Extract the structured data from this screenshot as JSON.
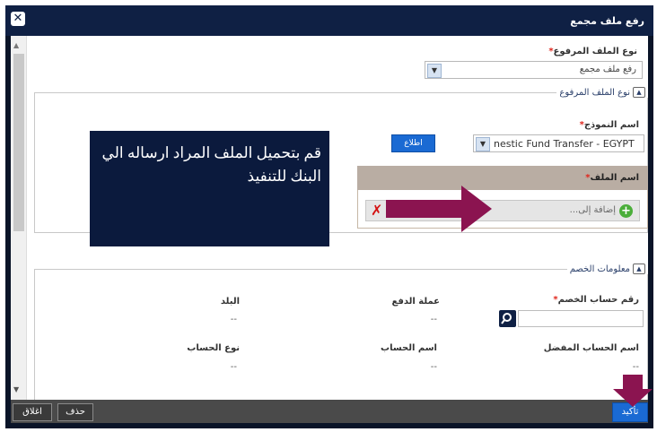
{
  "window": {
    "title": "رفع ملف مجمع",
    "close_label": "✕"
  },
  "upload_type": {
    "label": "نوع الملف المرفوع",
    "value": "رفع ملف مجمع"
  },
  "section1": {
    "legend": "نوع الملف المرفوع"
  },
  "template": {
    "label": "اسم النموذج",
    "value": "nestic Fund Transfer - EGYPT",
    "view_button": "اطلاع"
  },
  "file": {
    "label": "اسم الملف",
    "add_label": "إضافة إلى..."
  },
  "overlay": {
    "text": "قم بتحميل الملف المراد ارساله الي البنك للتنفيذ"
  },
  "section2": {
    "legend": "معلومات الخصم",
    "debit_account_label": "رقم حساب الخصم",
    "currency_label": "عملة الدفع",
    "currency_value": "--",
    "country_label": "البلد",
    "country_value": "--",
    "pref_name_label": "اسم الحساب المفضل",
    "pref_name_value": "--",
    "account_name_label": "اسم الحساب",
    "account_name_value": "--",
    "account_type_label": "نوع الحساب",
    "account_type_value": "--"
  },
  "footer": {
    "confirm": "تأكيد",
    "delete": "حذف",
    "close": "اغلاق"
  },
  "icons": {
    "close": "close-icon",
    "search": "search-icon",
    "add": "plus-circle-icon",
    "remove": "x-icon"
  },
  "colors": {
    "title_bar": "#0f2044",
    "overlay": "#0b1a3d",
    "arrow": "#8b1450",
    "button": "#1a6ad3"
  }
}
